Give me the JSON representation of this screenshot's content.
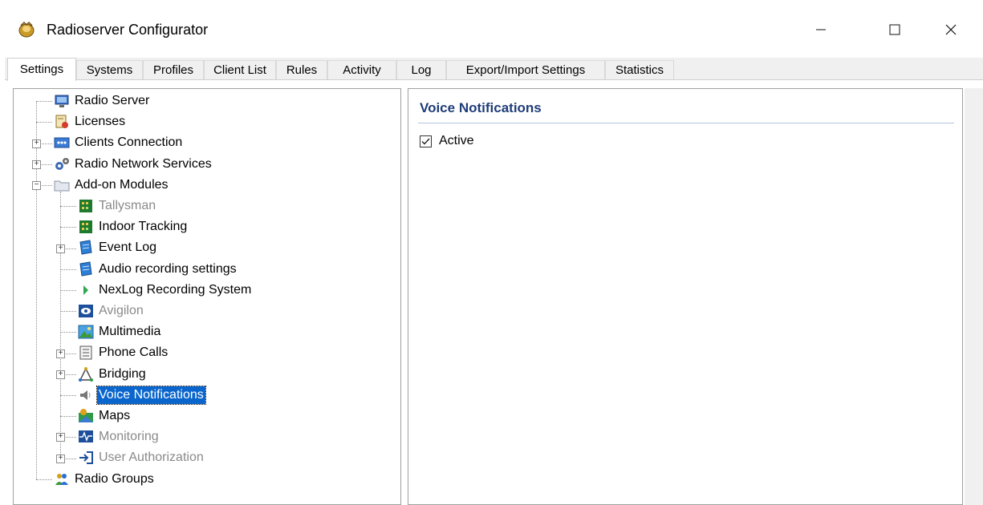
{
  "window": {
    "title": "Radioserver Configurator",
    "controls": {
      "minimize": "—",
      "maximize": "☐",
      "close": "✕"
    }
  },
  "tabs": [
    {
      "label": "Settings",
      "active": true
    },
    {
      "label": "Systems",
      "active": false
    },
    {
      "label": "Profiles",
      "active": false
    },
    {
      "label": "Client List",
      "active": false
    },
    {
      "label": "Rules",
      "active": false
    },
    {
      "label": "Activity",
      "active": false
    },
    {
      "label": "Log",
      "active": false
    },
    {
      "label": "Export/Import Settings",
      "active": false
    },
    {
      "label": "Statistics",
      "active": false
    }
  ],
  "tree": [
    {
      "label": "Radio Server",
      "icon": "monitor-icon",
      "level": 0,
      "expander": "none",
      "state": "normal"
    },
    {
      "label": "Licenses",
      "icon": "certificate-icon",
      "level": 0,
      "expander": "none",
      "state": "normal"
    },
    {
      "label": "Clients Connection",
      "icon": "network-icon",
      "level": 0,
      "expander": "plus",
      "state": "normal"
    },
    {
      "label": "Radio Network Services",
      "icon": "gears-icon",
      "level": 0,
      "expander": "plus",
      "state": "normal"
    },
    {
      "label": "Add-on Modules",
      "icon": "folder-icon",
      "level": 0,
      "expander": "minus",
      "state": "normal"
    },
    {
      "label": "Tallysman",
      "icon": "module-icon",
      "level": 1,
      "expander": "none",
      "state": "disabled"
    },
    {
      "label": "Indoor Tracking",
      "icon": "module-icon",
      "level": 1,
      "expander": "none",
      "state": "normal"
    },
    {
      "label": "Event Log",
      "icon": "log-icon",
      "level": 1,
      "expander": "plus",
      "state": "normal"
    },
    {
      "label": "Audio recording settings",
      "icon": "log-icon",
      "level": 1,
      "expander": "none",
      "state": "normal"
    },
    {
      "label": "NexLog Recording System",
      "icon": "play-arrow-icon",
      "level": 1,
      "expander": "none",
      "state": "normal"
    },
    {
      "label": "Avigilon",
      "icon": "eye-icon",
      "level": 1,
      "expander": "none",
      "state": "disabled"
    },
    {
      "label": "Multimedia",
      "icon": "picture-icon",
      "level": 1,
      "expander": "none",
      "state": "normal"
    },
    {
      "label": "Phone Calls",
      "icon": "phone-list-icon",
      "level": 1,
      "expander": "plus",
      "state": "normal"
    },
    {
      "label": "Bridging",
      "icon": "bridge-icon",
      "level": 1,
      "expander": "plus",
      "state": "normal"
    },
    {
      "label": "Voice Notifications",
      "icon": "speaker-icon",
      "level": 1,
      "expander": "none",
      "state": "selected"
    },
    {
      "label": "Maps",
      "icon": "map-icon",
      "level": 1,
      "expander": "none",
      "state": "normal"
    },
    {
      "label": "Monitoring",
      "icon": "pulse-icon",
      "level": 1,
      "expander": "plus",
      "state": "disabled"
    },
    {
      "label": "User Authorization",
      "icon": "login-arrow-icon",
      "level": 1,
      "expander": "plus",
      "state": "disabled"
    },
    {
      "label": "Radio Groups",
      "icon": "users-icon",
      "level": 0,
      "expander": "none",
      "state": "normal"
    }
  ],
  "detail": {
    "title": "Voice Notifications",
    "active_label": "Active",
    "active_checked": true
  },
  "colors": {
    "selection": "#0a66cc",
    "section_title": "#1e3c78",
    "disabled_text": "#8a8a8a"
  }
}
